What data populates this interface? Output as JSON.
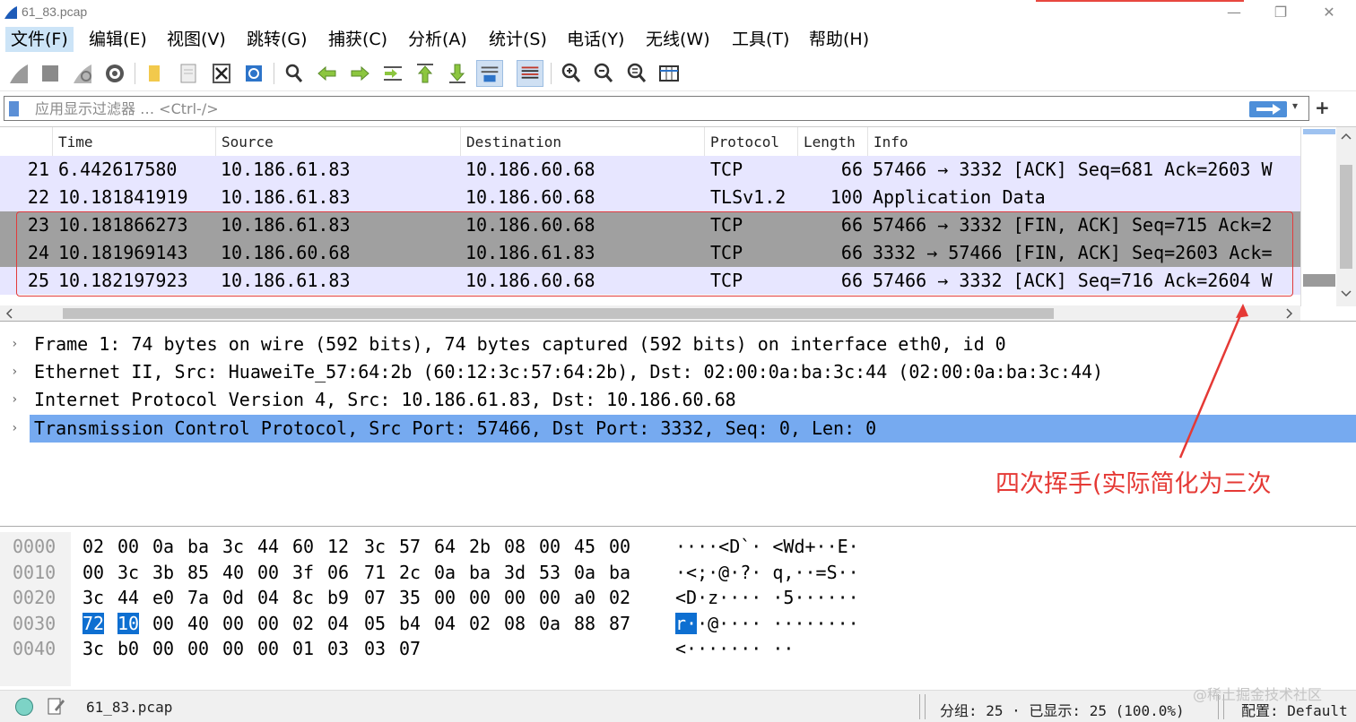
{
  "window": {
    "title": "61_83.pcap",
    "minimize": "—",
    "maximize": "❐",
    "close": "✕"
  },
  "menu": [
    {
      "label": "文件(F)",
      "active": true
    },
    {
      "label": "编辑(E)"
    },
    {
      "label": "视图(V)"
    },
    {
      "label": "跳转(G)"
    },
    {
      "label": "捕获(C)"
    },
    {
      "label": "分析(A)"
    },
    {
      "label": "统计(S)"
    },
    {
      "label": "电话(Y)"
    },
    {
      "label": "无线(W)"
    },
    {
      "label": "工具(T)"
    },
    {
      "label": "帮助(H)"
    }
  ],
  "toolbar": {
    "icons": [
      "shark-fin-start-icon",
      "stop-square-icon",
      "restart-fin-icon",
      "capture-options-gear-icon",
      "open-folder-icon",
      "save-file-icon",
      "close-file-icon",
      "reload-icon",
      "find-magnifier-icon",
      "go-back-arrow-icon",
      "go-forward-arrow-icon",
      "go-to-packet-icon",
      "first-packet-icon",
      "last-packet-icon",
      "autoscroll-icon",
      "colorize-icon",
      "zoom-in-icon",
      "zoom-out-icon",
      "zoom-normal-icon",
      "resize-columns-icon"
    ]
  },
  "filter": {
    "placeholder": "应用显示过滤器 … <Ctrl-/>",
    "dropdown": "▾",
    "add": "+"
  },
  "packet_list": {
    "columns": [
      "Time",
      "Source",
      "Destination",
      "Protocol",
      "Length",
      "Info"
    ],
    "rows": [
      {
        "no": "21",
        "time": "6.442617580",
        "src": "10.186.61.83",
        "dst": "10.186.60.68",
        "proto": "TCP",
        "len": "66",
        "info": "57466 → 3332 [ACK] Seq=681 Ack=2603 W",
        "style": "light"
      },
      {
        "no": "22",
        "time": "10.181841919",
        "src": "10.186.61.83",
        "dst": "10.186.60.68",
        "proto": "TLSv1.2",
        "len": "100",
        "info": "Application Data",
        "style": "light"
      },
      {
        "no": "23",
        "time": "10.181866273",
        "src": "10.186.61.83",
        "dst": "10.186.60.68",
        "proto": "TCP",
        "len": "66",
        "info": "57466 → 3332 [FIN, ACK] Seq=715 Ack=2",
        "style": "dark"
      },
      {
        "no": "24",
        "time": "10.181969143",
        "src": "10.186.60.68",
        "dst": "10.186.61.83",
        "proto": "TCP",
        "len": "66",
        "info": "3332 → 57466 [FIN, ACK] Seq=2603 Ack=",
        "style": "dark"
      },
      {
        "no": "25",
        "time": "10.182197923",
        "src": "10.186.61.83",
        "dst": "10.186.60.68",
        "proto": "TCP",
        "len": "66",
        "info": "57466 → 3332 [ACK] Seq=716 Ack=2604 W",
        "style": "light"
      }
    ]
  },
  "details": [
    {
      "text": "Frame 1: 74 bytes on wire (592 bits), 74 bytes captured (592 bits) on interface eth0, id 0",
      "selected": false
    },
    {
      "text": "Ethernet II, Src: HuaweiTe_57:64:2b (60:12:3c:57:64:2b), Dst: 02:00:0a:ba:3c:44 (02:00:0a:ba:3c:44)",
      "selected": false
    },
    {
      "text": "Internet Protocol Version 4, Src: 10.186.61.83, Dst: 10.186.60.68",
      "selected": false
    },
    {
      "text": "Transmission Control Protocol, Src Port: 57466, Dst Port: 3332, Seq: 0, Len: 0",
      "selected": true
    }
  ],
  "annotation": "四次挥手(实际简化为三次",
  "bytes": [
    {
      "offset": "0000",
      "hex": [
        "02",
        "00",
        "0a",
        "ba",
        "3c",
        "44",
        "60",
        "12",
        "3c",
        "57",
        "64",
        "2b",
        "08",
        "00",
        "45",
        "00"
      ],
      "ascii": "····<D`· <Wd+··E·"
    },
    {
      "offset": "0010",
      "hex": [
        "00",
        "3c",
        "3b",
        "85",
        "40",
        "00",
        "3f",
        "06",
        "71",
        "2c",
        "0a",
        "ba",
        "3d",
        "53",
        "0a",
        "ba"
      ],
      "ascii": "·<;·@·?· q,··=S··"
    },
    {
      "offset": "0020",
      "hex": [
        "3c",
        "44",
        "e0",
        "7a",
        "0d",
        "04",
        "8c",
        "b9",
        "07",
        "35",
        "00",
        "00",
        "00",
        "00",
        "a0",
        "02"
      ],
      "ascii": "<D·z···· ·5······"
    },
    {
      "offset": "0030",
      "hex": [
        "72",
        "10",
        "00",
        "40",
        "00",
        "00",
        "02",
        "04",
        "05",
        "b4",
        "04",
        "02",
        "08",
        "0a",
        "88",
        "87"
      ],
      "ascii": "r··@···· ········",
      "selected_hex": [
        0,
        1
      ],
      "selected_ascii": "r·"
    },
    {
      "offset": "0040",
      "hex": [
        "3c",
        "b0",
        "00",
        "00",
        "00",
        "00",
        "01",
        "03",
        "03",
        "07"
      ],
      "ascii": "<······· ··"
    }
  ],
  "status": {
    "file": "61_83.pcap",
    "stats": "分组: 25 · 已显示: 25 (100.0%)",
    "profile": "配置: Default"
  },
  "watermark": "@稀土掘金技术社区",
  "colors": {
    "row_light": "#e7e6ff",
    "row_dark": "#a0a0a0",
    "selection": "#76aaf0",
    "annotation": "#e53935"
  }
}
